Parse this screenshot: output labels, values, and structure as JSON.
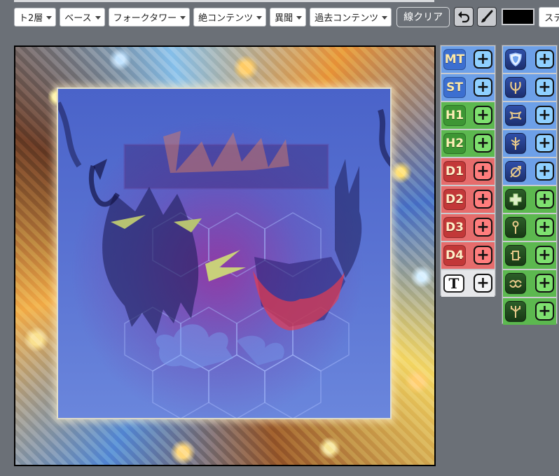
{
  "toolbar": {
    "floor_select": "ト2層",
    "base_select": "ベース",
    "tower_select": "フォークタワー",
    "ultimate_select": "絶コンテンツ",
    "variant_select": "異聞",
    "past_select": "過去コンテンツ",
    "clear_lines_label": "線クリア",
    "stage_select": "ステー",
    "pen_color": "#000000"
  },
  "roles_left": [
    {
      "label": "MT",
      "role": "tank"
    },
    {
      "label": "ST",
      "role": "tank"
    },
    {
      "label": "H1",
      "role": "healer"
    },
    {
      "label": "H2",
      "role": "healer"
    },
    {
      "label": "D1",
      "role": "dps"
    },
    {
      "label": "D2",
      "role": "dps"
    },
    {
      "label": "D3",
      "role": "dps"
    },
    {
      "label": "D4",
      "role": "dps"
    },
    {
      "label": "T",
      "role": "text"
    }
  ],
  "roles_right": [
    {
      "icon": "paladin-shield-icon",
      "role": "tank"
    },
    {
      "icon": "warrior-axe-icon",
      "role": "tank"
    },
    {
      "icon": "darkknight-icon",
      "role": "tank"
    },
    {
      "icon": "gunbreaker-icon",
      "role": "tank"
    },
    {
      "icon": "tank-generic-icon",
      "role": "tank"
    },
    {
      "icon": "whitemage-cross-icon",
      "role": "healer"
    },
    {
      "icon": "scholar-icon",
      "role": "healer"
    },
    {
      "icon": "astrologian-icon",
      "role": "healer"
    },
    {
      "icon": "sage-icon",
      "role": "healer"
    },
    {
      "icon": "healer-generic-icon",
      "role": "healer"
    }
  ],
  "add_label": "+",
  "colors": {
    "tank": "#6da0e8",
    "healer": "#5cb84f",
    "dps": "#e66c6c",
    "text": "#e6e7ea"
  }
}
